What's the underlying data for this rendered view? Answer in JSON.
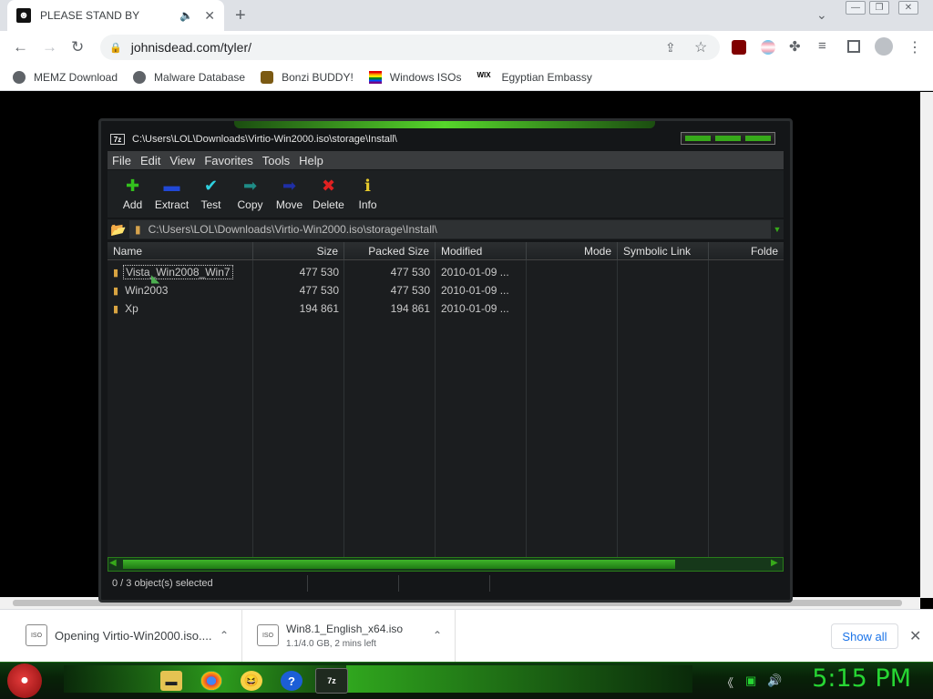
{
  "browser": {
    "tab_title": "PLEASE STAND BY",
    "url": "johnisdead.com/tyler/",
    "bookmarks": [
      {
        "label": "MEMZ Download",
        "icon": "globe-icon"
      },
      {
        "label": "Malware Database",
        "icon": "globe-icon"
      },
      {
        "label": "Bonzi BUDDY!",
        "icon": "bonzi-icon"
      },
      {
        "label": "Windows ISOs",
        "icon": "windows-flag-icon"
      },
      {
        "label": "Egyptian Embassy",
        "icon": "wix-icon"
      }
    ],
    "show_all_label": "Show all"
  },
  "sevenzip": {
    "title": "C:\\Users\\LOL\\Downloads\\Virtio-Win2000.iso\\storage\\Install\\",
    "menu": [
      "File",
      "Edit",
      "View",
      "Favorites",
      "Tools",
      "Help"
    ],
    "toolbar": [
      {
        "label": "Add",
        "icon": "plus-icon",
        "color": "#33c11d",
        "glyph": "✚"
      },
      {
        "label": "Extract",
        "icon": "minus-icon",
        "color": "#2148d6",
        "glyph": "▬"
      },
      {
        "label": "Test",
        "icon": "check-icon",
        "color": "#2fd1e0",
        "glyph": "✔"
      },
      {
        "label": "Copy",
        "icon": "copy-arrow-icon",
        "color": "#1f8c86",
        "glyph": "➡"
      },
      {
        "label": "Move",
        "icon": "move-arrow-icon",
        "color": "#1f2fa6",
        "glyph": "➡"
      },
      {
        "label": "Delete",
        "icon": "delete-x-icon",
        "color": "#e02121",
        "glyph": "✖"
      },
      {
        "label": "Info",
        "icon": "info-icon",
        "color": "#e5c92b",
        "glyph": "ℹ"
      }
    ],
    "address": "C:\\Users\\LOL\\Downloads\\Virtio-Win2000.iso\\storage\\Install\\",
    "columns": [
      "Name",
      "Size",
      "Packed Size",
      "Modified",
      "Mode",
      "Symbolic Link",
      "Folde"
    ],
    "rows": [
      {
        "name": "Vista_Win2008_Win7",
        "size": "477 530",
        "packed": "477 530",
        "modified": "2010-01-09 ..."
      },
      {
        "name": "Win2003",
        "size": "477 530",
        "packed": "477 530",
        "modified": "2010-01-09 ..."
      },
      {
        "name": "Xp",
        "size": "194 861",
        "packed": "194 861",
        "modified": "2010-01-09 ..."
      }
    ],
    "status": "0 / 3 object(s) selected"
  },
  "downloads": [
    {
      "name": "Opening Virtio-Win2000.iso....",
      "detail": ""
    },
    {
      "name": "Win8.1_English_x64.iso",
      "detail": "1.1/4.0 GB, 2 mins left"
    }
  ],
  "taskbar": {
    "clock": "5:15 PM"
  }
}
